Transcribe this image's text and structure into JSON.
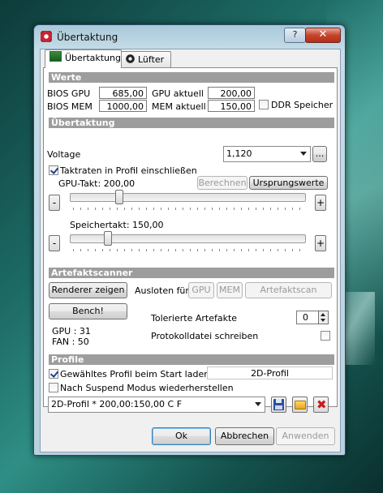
{
  "window": {
    "title": "Übertaktung",
    "help_glyph": "?",
    "close_glyph": "✕"
  },
  "tabs": [
    {
      "label": "Übertaktung",
      "active": true,
      "icon": "graphics-card-icon"
    },
    {
      "label": "Lüfter",
      "active": false,
      "icon": "fan-icon"
    }
  ],
  "werte": {
    "header": "Werte",
    "bios_gpu_label": "BIOS GPU",
    "bios_gpu": "685,00",
    "bios_mem_label": "BIOS MEM",
    "bios_mem": "1000,00",
    "gpu_aktuell_label": "GPU aktuell",
    "gpu_aktuell": "200,00",
    "mem_aktuell_label": "MEM aktuell",
    "mem_aktuell": "150,00",
    "ddr_label": "DDR Speicher",
    "ddr_checked": false
  },
  "uebertaktung": {
    "header": "Übertaktung",
    "voltage_label": "Voltage",
    "voltage_value": "1,120",
    "browse_label": "...",
    "profil_checkbox_label": "Taktraten in Profil einschließen",
    "profil_checked": true,
    "berechnen_label": "Berechnen",
    "ursprungswerte_label": "Ursprungswerte",
    "gpu_takt_label": "GPU-Takt: 200,00",
    "speichertakt_label": "Speichertakt: 150,00",
    "minus": "-",
    "plus": "+",
    "gpu_slider_fraction": 0.2,
    "mem_slider_fraction": 0.15
  },
  "artefakt": {
    "header": "Artefaktscanner",
    "renderer_label": "Renderer zeigen",
    "bench_label": "Bench!",
    "ausloten_label": "Ausloten für",
    "gpu_btn": "GPU",
    "mem_btn": "MEM",
    "scan_btn": "Artefaktscan",
    "tolerierte_label": "Tolerierte Artefakte",
    "tolerierte_value": "0",
    "protokoll_label": "Protokolldatei schreiben",
    "protokoll_checked": false,
    "gpu_status": "GPU : 31",
    "fan_status": "FAN : 50"
  },
  "profile": {
    "header": "Profile",
    "start_label": "Gewähltes Profil beim Start laden",
    "start_checked": true,
    "start_profile": "2D-Profil",
    "suspend_label": "Nach Suspend Modus wiederherstellen",
    "suspend_checked": false,
    "selected": "2D-Profil * 200,00:150,00 C  F"
  },
  "buttons": {
    "ok": "Ok",
    "abbrechen": "Abbrechen",
    "anwenden": "Anwenden"
  }
}
